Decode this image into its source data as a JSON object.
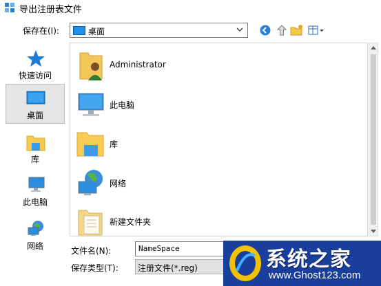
{
  "window": {
    "title": "导出注册表文件"
  },
  "savein": {
    "label": "保存在(I):",
    "value": "桌面"
  },
  "places": [
    {
      "label": "快速访问",
      "icon": "star-icon"
    },
    {
      "label": "桌面",
      "icon": "desktop-icon",
      "selected": true
    },
    {
      "label": "库",
      "icon": "library-icon"
    },
    {
      "label": "此电脑",
      "icon": "computer-icon"
    },
    {
      "label": "网络",
      "icon": "network-icon"
    }
  ],
  "files": [
    {
      "name": "Administrator",
      "icon": "user-folder-icon"
    },
    {
      "name": "此电脑",
      "icon": "computer-icon"
    },
    {
      "name": "库",
      "icon": "library-icon"
    },
    {
      "name": "网络",
      "icon": "network-icon"
    },
    {
      "name": "新建文件夹",
      "icon": "folder-icon"
    }
  ],
  "filename": {
    "label": "文件名(N):",
    "value": "NameSpace"
  },
  "filetype": {
    "label": "保存类型(T):",
    "value": "注册文件(*.reg)"
  },
  "watermark": {
    "title": "系统之家",
    "url": "www.Ghost123.com"
  },
  "colors": {
    "accent": "#0078d7",
    "selected_bg": "#e5e5e5",
    "watermark_bg": "#1a3e9c"
  }
}
